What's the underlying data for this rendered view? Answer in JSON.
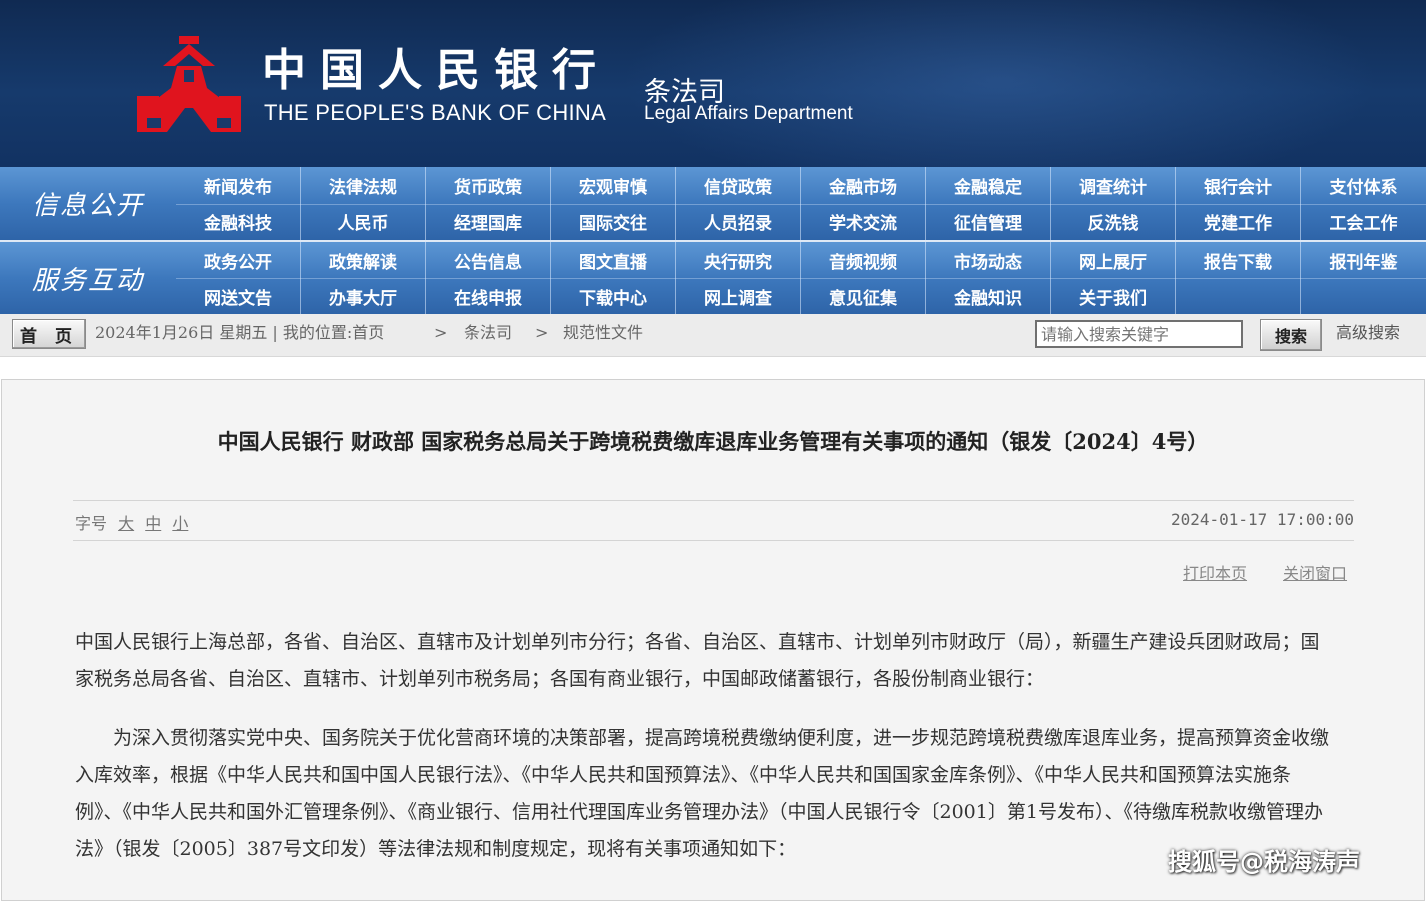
{
  "header": {
    "bank_name_cn": "中国人民银行",
    "bank_name_en": "THE PEOPLE'S BANK OF CHINA",
    "department_cn": "条法司",
    "department_en": "Legal Affairs Department",
    "logo_color": "#e0141e"
  },
  "nav": {
    "info_title": "信息公开",
    "info_row1": [
      "新闻发布",
      "法律法规",
      "货币政策",
      "宏观审慎",
      "信贷政策",
      "金融市场",
      "金融稳定",
      "调查统计",
      "银行会计",
      "支付体系"
    ],
    "info_row2": [
      "金融科技",
      "人民币",
      "经理国库",
      "国际交往",
      "人员招录",
      "学术交流",
      "征信管理",
      "反洗钱",
      "党建工作",
      "工会工作"
    ],
    "service_title": "服务互动",
    "service_row1": [
      "政务公开",
      "政策解读",
      "公告信息",
      "图文直播",
      "央行研究",
      "音频视频",
      "市场动态",
      "网上展厅",
      "报告下载",
      "报刊年鉴"
    ],
    "service_row2": [
      "网送文告",
      "办事大厅",
      "在线申报",
      "下载中心",
      "网上调查",
      "意见征集",
      "金融知识",
      "关于我们"
    ]
  },
  "crumbbar": {
    "home_label": "首 页",
    "date_text": "2024年1月26日  星期五  |  我的位置:首页",
    "sep1": ">",
    "crumb2": "条法司",
    "sep2": ">",
    "crumb3": "规范性文件",
    "search_placeholder": "请输入搜索关键字",
    "search_button": "搜索",
    "advanced_search": "高级搜索"
  },
  "article": {
    "title": "中国人民银行 财政部 国家税务总局关于跨境税费缴库退库业务管理有关事项的通知（银发〔2024〕4号）",
    "font_size_label": "字号",
    "font_size_options": [
      "大",
      "中",
      "小"
    ],
    "publish_time": "2024-01-17 17:00:00",
    "print_link": "打印本页",
    "close_link": "关闭窗口",
    "paragraph1": "中国人民银行上海总部，各省、自治区、直辖市及计划单列市分行；各省、自治区、直辖市、计划单列市财政厅（局），新疆生产建设兵团财政局；国家税务总局各省、自治区、直辖市、计划单列市税务局；各国有商业银行，中国邮政储蓄银行，各股份制商业银行：",
    "paragraph2": "为深入贯彻落实党中央、国务院关于优化营商环境的决策部署，提高跨境税费缴纳便利度，进一步规范跨境税费缴库退库业务，提高预算资金收缴入库效率，根据《中华人民共和国中国人民银行法》、《中华人民共和国预算法》、《中华人民共和国国家金库条例》、《中华人民共和国预算法实施条例》、《中华人民共和国外汇管理条例》、《商业银行、信用社代理国库业务管理办法》（中国人民银行令〔2001〕第1号发布）、《待缴库税款收缴管理办法》（银发〔2005〕387号文印发）等法律法规和制度规定，现将有关事项通知如下："
  },
  "watermark": "搜狐号@税海涛声"
}
